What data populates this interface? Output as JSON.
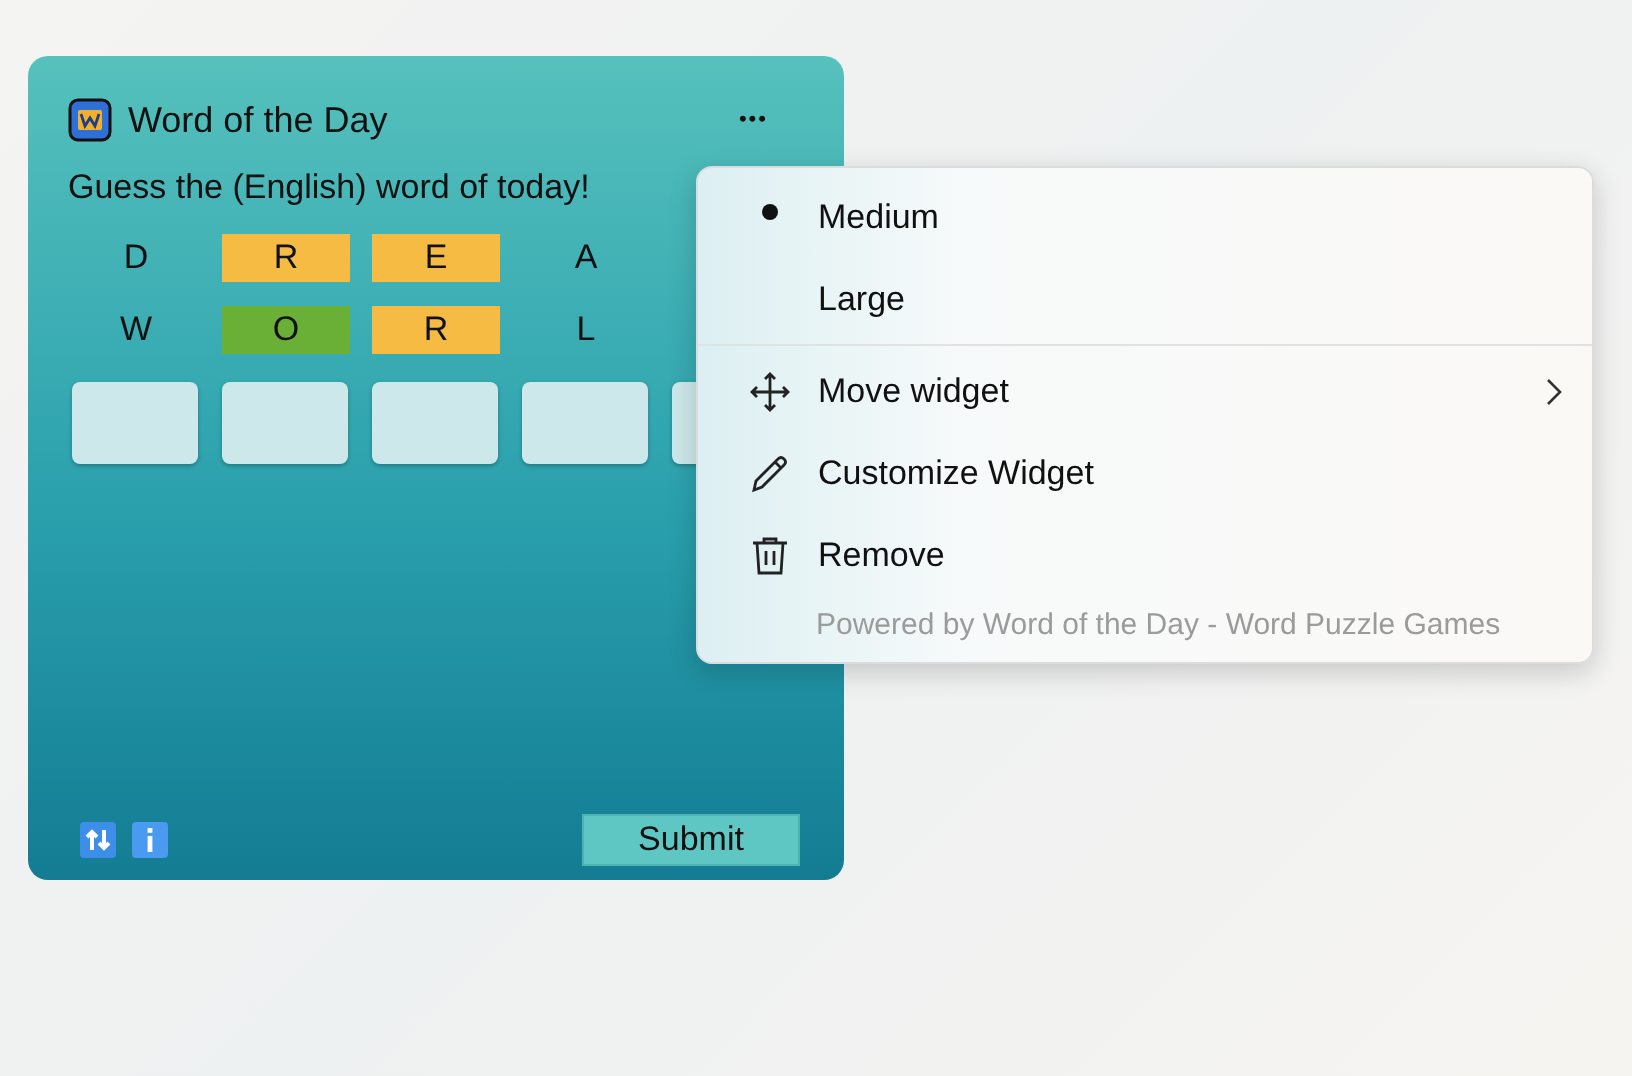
{
  "widget": {
    "title": "Word of the Day",
    "more_button": "•••",
    "prompt": "Guess the (English) word of today!",
    "guesses": [
      [
        {
          "letter": "D"
        },
        {
          "letter": "R",
          "color": "#f5bb43"
        },
        {
          "letter": "E",
          "color": "#f5bb43"
        },
        {
          "letter": "A"
        }
      ],
      [
        {
          "letter": "W"
        },
        {
          "letter": "O",
          "color": "#6bb036"
        },
        {
          "letter": "R",
          "color": "#f5bb43"
        },
        {
          "letter": "L"
        }
      ]
    ],
    "submit_button": "Submit"
  },
  "menu": {
    "size_options": [
      {
        "label": "Medium",
        "selected": true
      },
      {
        "label": "Large",
        "selected": false
      }
    ],
    "actions": [
      {
        "label": "Move widget",
        "kind": "move",
        "submenu": true
      },
      {
        "label": "Customize Widget",
        "kind": "edit",
        "submenu": false
      },
      {
        "label": "Remove",
        "kind": "delete",
        "submenu": false
      }
    ],
    "footer": "Powered by Word of the Day - Word Puzzle Games"
  }
}
